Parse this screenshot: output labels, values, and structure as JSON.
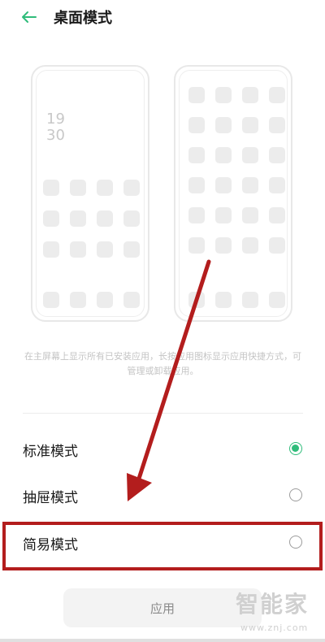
{
  "header": {
    "back_icon": "arrow-left-icon",
    "title": "桌面模式",
    "accent_color": "#2fbc7a"
  },
  "preview": {
    "standard_clock": "19\n30",
    "icon_color": "#ececec"
  },
  "description": "在主屏幕上显示所有已安装应用，长按应用图标显示应用快捷方式，可管理或卸载应用。",
  "options": [
    {
      "label": "标准模式",
      "selected": true
    },
    {
      "label": "抽屉模式",
      "selected": false
    },
    {
      "label": "简易模式",
      "selected": false
    }
  ],
  "apply_label": "应用",
  "annotation_color": "#b31d1d",
  "watermark": {
    "text": "智能家",
    "url": "www.znj.com"
  }
}
